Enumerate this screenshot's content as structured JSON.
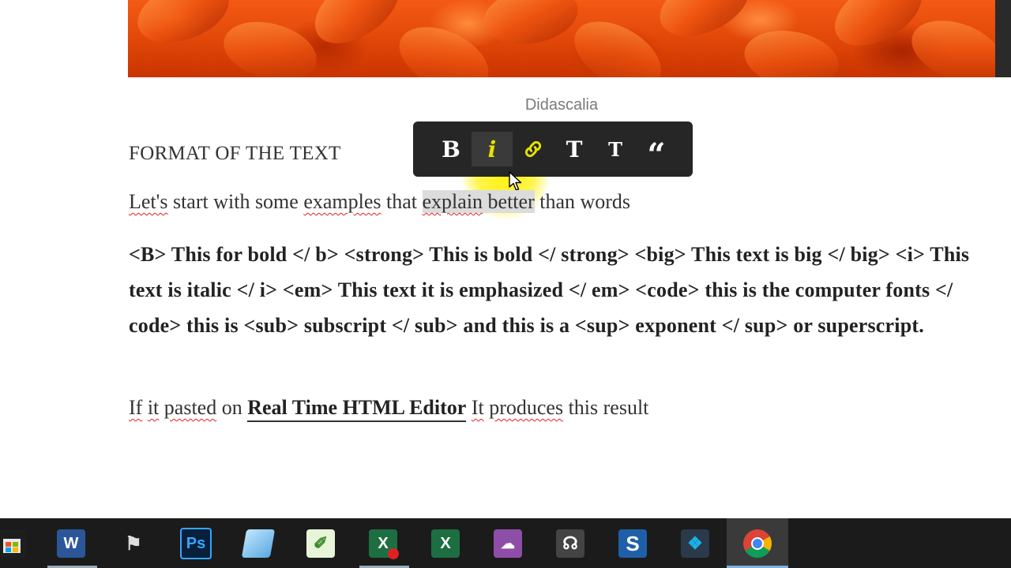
{
  "caption": "Didascalia",
  "heading": "FORMAT OF THE TEXT",
  "toolbar": {
    "bold": "B",
    "italic": "i",
    "link_icon": "link-icon",
    "title_large": "T",
    "title_small": "T",
    "quote": "“",
    "active": "italic",
    "highlight_color": "#e6e000"
  },
  "para1": {
    "w1": "Let's",
    "w2": " start with some ",
    "w3": "examples",
    "w4": " that ",
    "w5": "explain",
    "w6": " better",
    "w7": " than words"
  },
  "para2": "<B> This for bold </ b> <strong> This is bold </ strong> <big> This text is big </ big> <i> This text is italic </ i> <em> This text it is emphasized </ em> <code> this is the computer fonts </ code> this is <sub> subscript </ sub> and this is a <sup> exponent </ sup> or superscript.",
  "para3": {
    "w1": "If",
    "w2": " ",
    "w3": "it",
    "w4": " ",
    "w5": "pasted",
    "w6": " on ",
    "link": "Real Time HTML Editor",
    "w7": " ",
    "w8": "It",
    "w9": " ",
    "w10": "produces",
    "w11": " this result"
  },
  "taskbar": {
    "icons": [
      "store-icon",
      "word-icon",
      "gimp-icon",
      "photoshop-icon",
      "notepad-plus-icon",
      "notepad-icon",
      "excel-record-icon",
      "excel-icon",
      "onenote-icon",
      "headphones-icon",
      "snagit-icon",
      "kodi-icon",
      "chrome-icon"
    ],
    "active": "chrome-icon"
  }
}
